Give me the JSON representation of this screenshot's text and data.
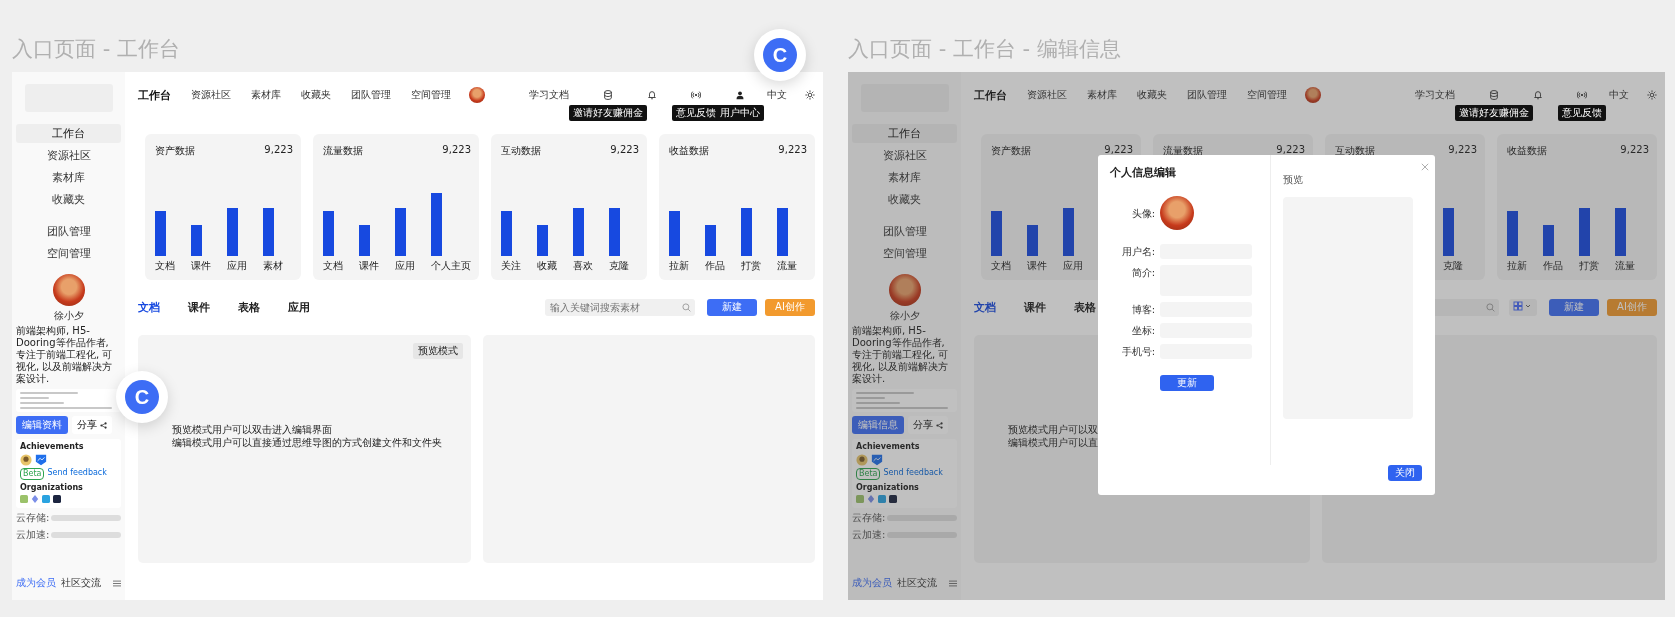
{
  "frames": [
    {
      "title": "入口页面 - 工作台",
      "markers": [
        {
          "text": "C"
        },
        {
          "text": "C"
        }
      ],
      "sidebar": {
        "nav": [
          {
            "label": "工作台",
            "selected": true
          },
          {
            "label": "资源社区",
            "selected": false
          },
          {
            "label": "素材库",
            "selected": false
          },
          {
            "label": "收藏夹",
            "selected": false
          }
        ],
        "nav2": [
          {
            "label": "团队管理",
            "selected": false
          },
          {
            "label": "空间管理",
            "selected": false
          }
        ],
        "profile": {
          "name": "徐小夕",
          "bio": "前端架构师, H5-Dooring等作品作者, 专注于前端工程化, 可视化, 以及前端解决方案设计.",
          "edit_button": "编辑资料",
          "share_button": "分享"
        },
        "achievements": {
          "title": "Achievements",
          "beta": "Beta",
          "feedback": "Send feedback",
          "org_title": "Organizations"
        },
        "storage": [
          {
            "label": "云存储:"
          },
          {
            "label": "云加速:"
          }
        ],
        "footer": {
          "member": "成为会员",
          "community": "社区交流"
        }
      },
      "topbar": {
        "title": "工作台",
        "nav": [
          "资源社区",
          "素材库",
          "收藏夹",
          "团队管理",
          "空间管理"
        ],
        "docs": "学习文档",
        "icons": [
          {
            "kind": "database",
            "tooltip": "邀请好友赚佣金"
          },
          {
            "kind": "bell"
          },
          {
            "kind": "broadcast",
            "tooltip": "意见反馈"
          },
          {
            "kind": "user",
            "tooltip": "用户中心"
          }
        ],
        "language": "中文"
      },
      "cards": [
        {
          "title": "资产数据",
          "value": "9,223",
          "categories": [
            "文档",
            "课件",
            "应用",
            "素材"
          ]
        },
        {
          "title": "流量数据",
          "value": "9,223",
          "categories": [
            "文档",
            "课件",
            "应用",
            "个人主页"
          ]
        },
        {
          "title": "互动数据",
          "value": "9,223",
          "categories": [
            "关注",
            "收藏",
            "喜欢",
            "克隆"
          ]
        },
        {
          "title": "收益数据",
          "value": "9,223",
          "categories": [
            "拉新",
            "作品",
            "打赏",
            "流量"
          ]
        }
      ],
      "tabs": [
        {
          "label": "文档",
          "selected": true
        },
        {
          "label": "课件",
          "selected": false
        },
        {
          "label": "表格",
          "selected": false
        },
        {
          "label": "应用",
          "selected": false
        }
      ],
      "search": {
        "placeholder": "输入关键词搜索素材"
      },
      "new_button": "新建",
      "ai_button": "AI创作",
      "preview_panel": {
        "badge": "预览模式",
        "lines": [
          "预览模式用户可以双击进入编辑界面",
          "编辑模式用户可以直接通过思维导图的方式创建文件和文件夹"
        ]
      }
    },
    {
      "title": "入口页面 - 工作台 - 编辑信息",
      "sidebar": {
        "nav": [
          {
            "label": "工作台",
            "selected": true
          },
          {
            "label": "资源社区",
            "selected": false
          },
          {
            "label": "素材库",
            "selected": false
          },
          {
            "label": "收藏夹",
            "selected": false
          }
        ],
        "nav2": [
          {
            "label": "团队管理",
            "selected": false
          },
          {
            "label": "空间管理",
            "selected": false
          }
        ],
        "profile": {
          "name": "徐小夕",
          "bio": "前端架构师, H5-Dooring等作品作者, 专注于前端工程化, 可视化, 以及前端解决方案设计.",
          "edit_button": "编辑信息",
          "share_button": "分享"
        },
        "achievements": {
          "title": "Achievements",
          "beta": "Beta",
          "feedback": "Send feedback",
          "org_title": "Organizations"
        },
        "storage": [
          {
            "label": "云存储:"
          },
          {
            "label": "云加速:"
          }
        ],
        "footer": {
          "member": "成为会员",
          "community": "社区交流"
        }
      },
      "topbar": {
        "title": "工作台",
        "nav": [
          "资源社区",
          "素材库",
          "收藏夹",
          "团队管理",
          "空间管理"
        ],
        "docs": "学习文档",
        "icons": [
          {
            "kind": "database",
            "tooltip": "邀请好友赚佣金"
          },
          {
            "kind": "bell"
          },
          {
            "kind": "broadcast",
            "tooltip": "意见反馈"
          }
        ],
        "language": "中文"
      },
      "cards": [
        {
          "title": "资产数据",
          "value": "9,223",
          "categories": [
            "文档",
            "课件",
            "应用"
          ]
        },
        {
          "title": "流量数据",
          "value": "9,223"
        },
        {
          "title": "互动数据",
          "value": "9,223",
          "categories_end": [
            "克隆"
          ]
        },
        {
          "title": "收益数据",
          "value": "9,223",
          "categories": [
            "拉新",
            "作品",
            "打赏",
            "流量"
          ]
        }
      ],
      "tabs": [
        {
          "label": "文档",
          "selected": true
        },
        {
          "label": "课件",
          "selected": false
        },
        {
          "label": "表格",
          "selected": false
        }
      ],
      "view_toggle": true,
      "new_button": "新建",
      "ai_button": "AI创作",
      "preview_panel": {
        "lines": [
          "预览模式用户可以双",
          "编辑模式用户可以直"
        ]
      },
      "modal": {
        "title": "个人信息编辑",
        "avatar_label": "头像:",
        "fields": [
          {
            "label": "用户名:",
            "kind": "input"
          },
          {
            "label": "简介:",
            "kind": "textarea"
          },
          {
            "label": "博客:",
            "kind": "input"
          },
          {
            "label": "坐标:",
            "kind": "input"
          },
          {
            "label": "手机号:",
            "kind": "input"
          }
        ],
        "update_button": "更新",
        "preview_label": "预览",
        "close_button": "关闭"
      }
    }
  ]
}
